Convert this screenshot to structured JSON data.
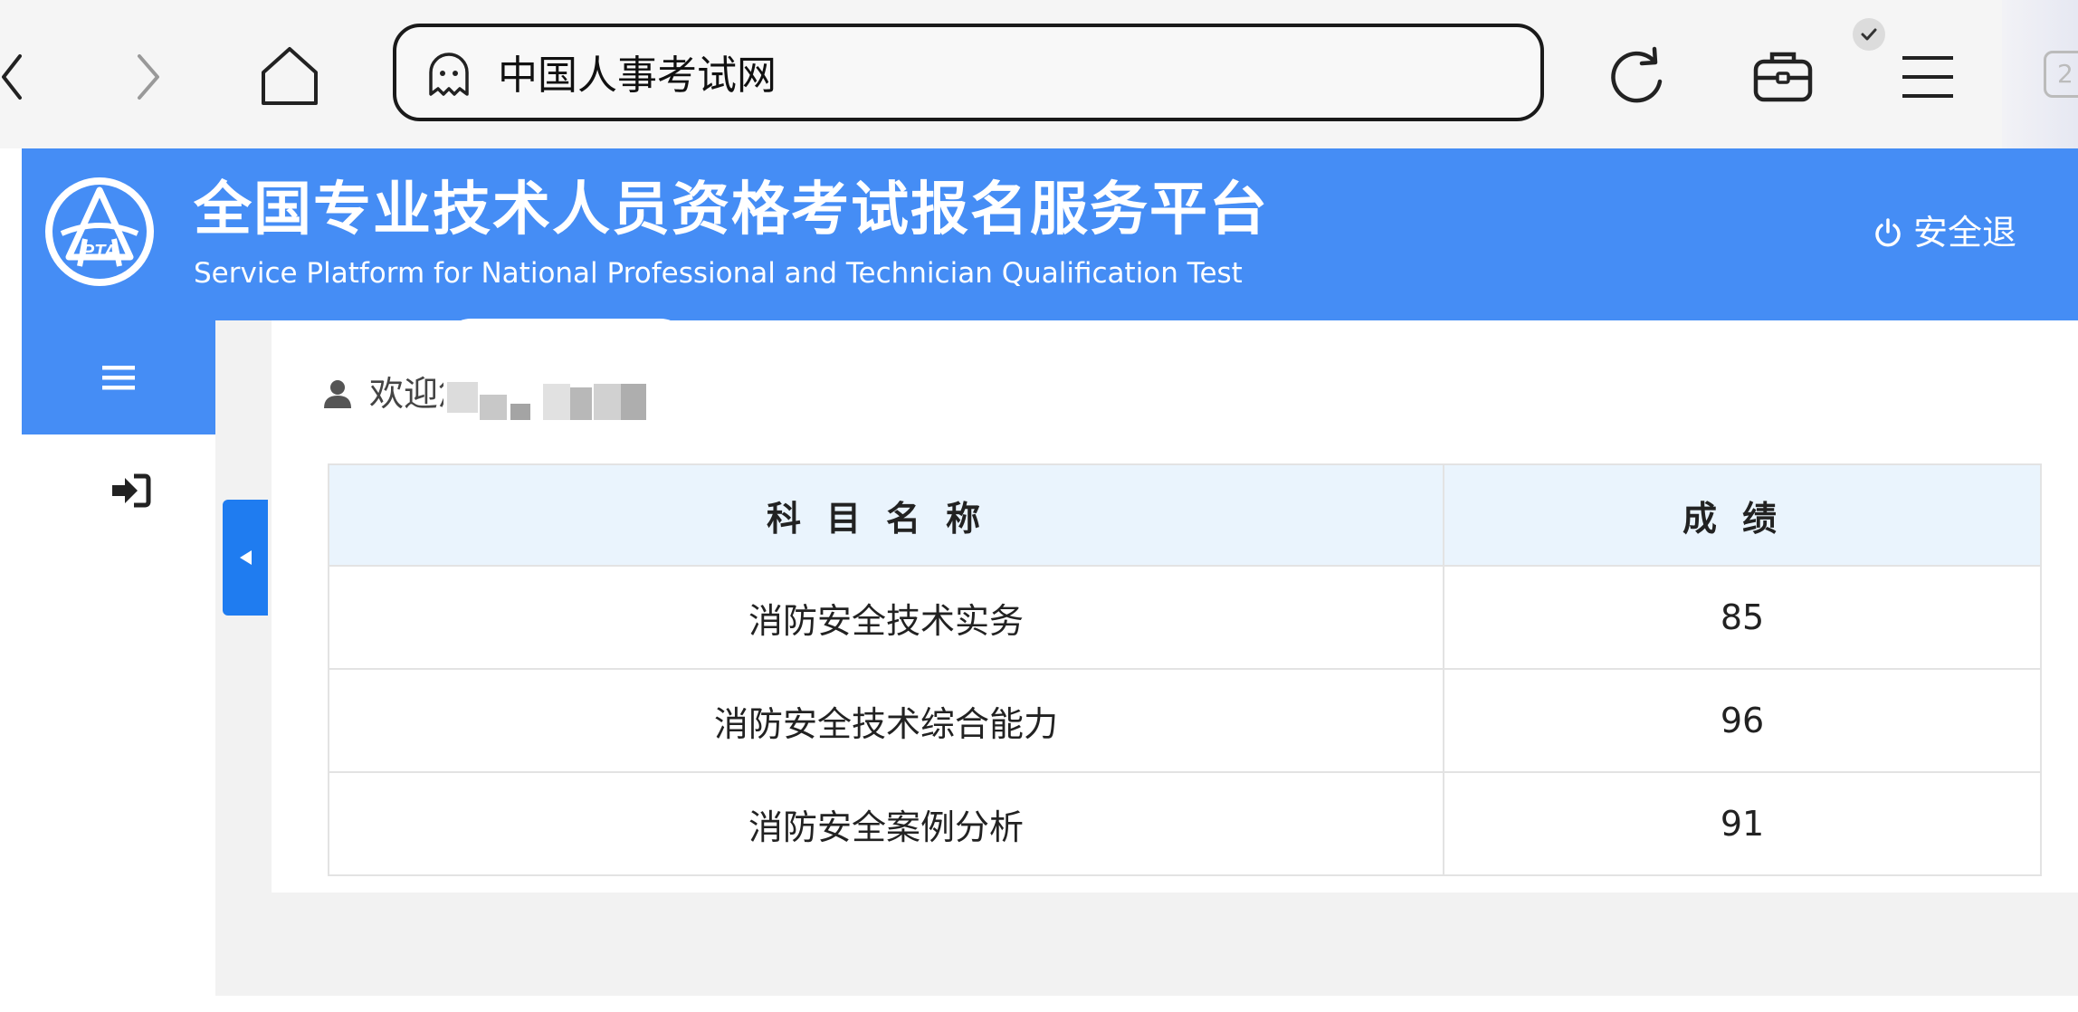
{
  "browser": {
    "address_text": "中国人事考试网",
    "tabs_count": "2"
  },
  "site": {
    "title_cn": "全国专业技术人员资格考试报名服务平台",
    "title_en": "Service Platform for National Professional and Technician Qualification Test",
    "logo_text": "PTA",
    "logout_label": "安全退"
  },
  "welcome": {
    "text": "欢迎您"
  },
  "table": {
    "headers": [
      "科目名称",
      "成绩"
    ],
    "rows": [
      {
        "subject": "消防安全技术实务",
        "score": "85"
      },
      {
        "subject": "消防安全技术综合能力",
        "score": "96"
      },
      {
        "subject": "消防安全案例分析",
        "score": "91"
      }
    ]
  },
  "colors": {
    "brand_blue": "#458df5",
    "table_header_bg": "#eaf4fd",
    "collapse_tab": "#1f7cf0"
  }
}
